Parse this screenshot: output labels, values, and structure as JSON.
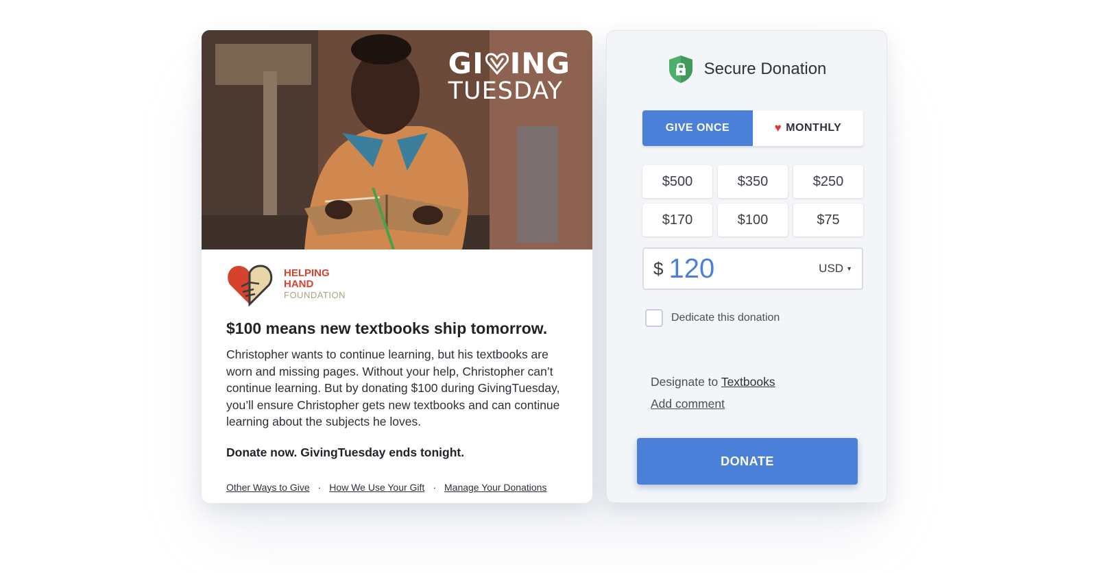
{
  "campaign": {
    "logo_line1_a": "GI",
    "logo_line1_b": "ING",
    "logo_line2": "TUESDAY"
  },
  "organization": {
    "name_line1": "HELPING",
    "name_line2": "HAND",
    "name_line3": "FOUNDATION"
  },
  "story": {
    "headline": "$100 means new textbooks ship tomorrow.",
    "body": "Christopher wants to continue learning, but his textbooks are worn and missing pages. Without your help, Christopher can’t continue learning. But by donating $100 during GivingTuesday, you’ll ensure Christopher gets new textbooks and can continue learning about the subjects he loves.",
    "cta": "Donate now. GivingTuesday ends tonight."
  },
  "footer_links": [
    "Other Ways to Give",
    "How We Use Your Gift",
    "Manage Your Donations"
  ],
  "footer_separator": "·",
  "donation_form": {
    "title": "Secure Donation",
    "frequency": {
      "once_label": "GIVE ONCE",
      "monthly_label": "MONTHLY",
      "selected": "once"
    },
    "preset_amounts": [
      "$500",
      "$350",
      "$250",
      "$170",
      "$100",
      "$75"
    ],
    "custom_amount": {
      "currency_symbol": "$",
      "value": "120",
      "currency_code": "USD"
    },
    "dedicate_label": "Dedicate this donation",
    "dedicate_checked": false,
    "designate_prefix": "Designate to ",
    "designate_target": "Textbooks",
    "add_comment_label": "Add comment",
    "donate_label": "DONATE"
  },
  "colors": {
    "primary": "#4a80d8",
    "shield": "#4caf6a",
    "heart": "#e0383d",
    "org_red": "#d5432f",
    "org_tan": "#a9a27e"
  },
  "icons": {
    "shield": "lock-shield-icon",
    "heart": "heart-icon",
    "caret": "caret-down-icon"
  }
}
